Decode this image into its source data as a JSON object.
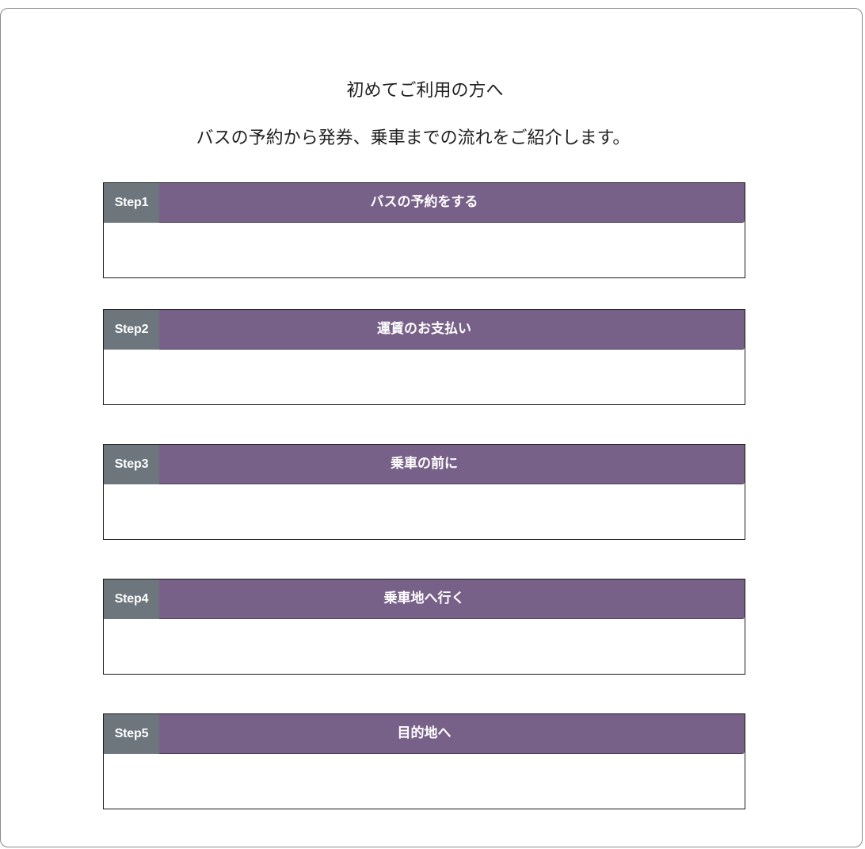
{
  "header": {
    "title": "初めてご利用の方へ",
    "subtitle": "バスの予約から発券、乗車までの流れをご紹介します。"
  },
  "steps": [
    {
      "number": "Step1",
      "title": "バスの予約をする"
    },
    {
      "number": "Step2",
      "title": "運賃のお支払い"
    },
    {
      "number": "Step3",
      "title": "乗車の前に"
    },
    {
      "number": "Step4",
      "title": "乗車地へ行く"
    },
    {
      "number": "Step5",
      "title": "目的地へ"
    }
  ],
  "colors": {
    "header_bar": "#786189",
    "step_label_bg": "#6d767d",
    "text_on_bar": "#ffffff",
    "border": "#1a1a1a"
  }
}
